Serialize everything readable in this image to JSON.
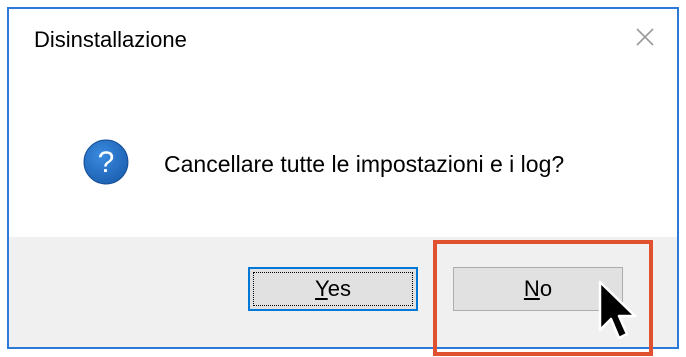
{
  "dialog": {
    "title": "Disinstallazione",
    "message": "Cancellare tutte le impostazioni e i log?",
    "icon": "question-icon",
    "close_icon": "close-icon",
    "accent_color": "#2b79d9"
  },
  "buttons": {
    "yes_first": "Y",
    "yes_rest": "es",
    "no_first": "N",
    "no_rest": "o"
  },
  "annotation": {
    "highlight_color": "#e0522f",
    "cursor": "mouse-pointer-icon"
  }
}
